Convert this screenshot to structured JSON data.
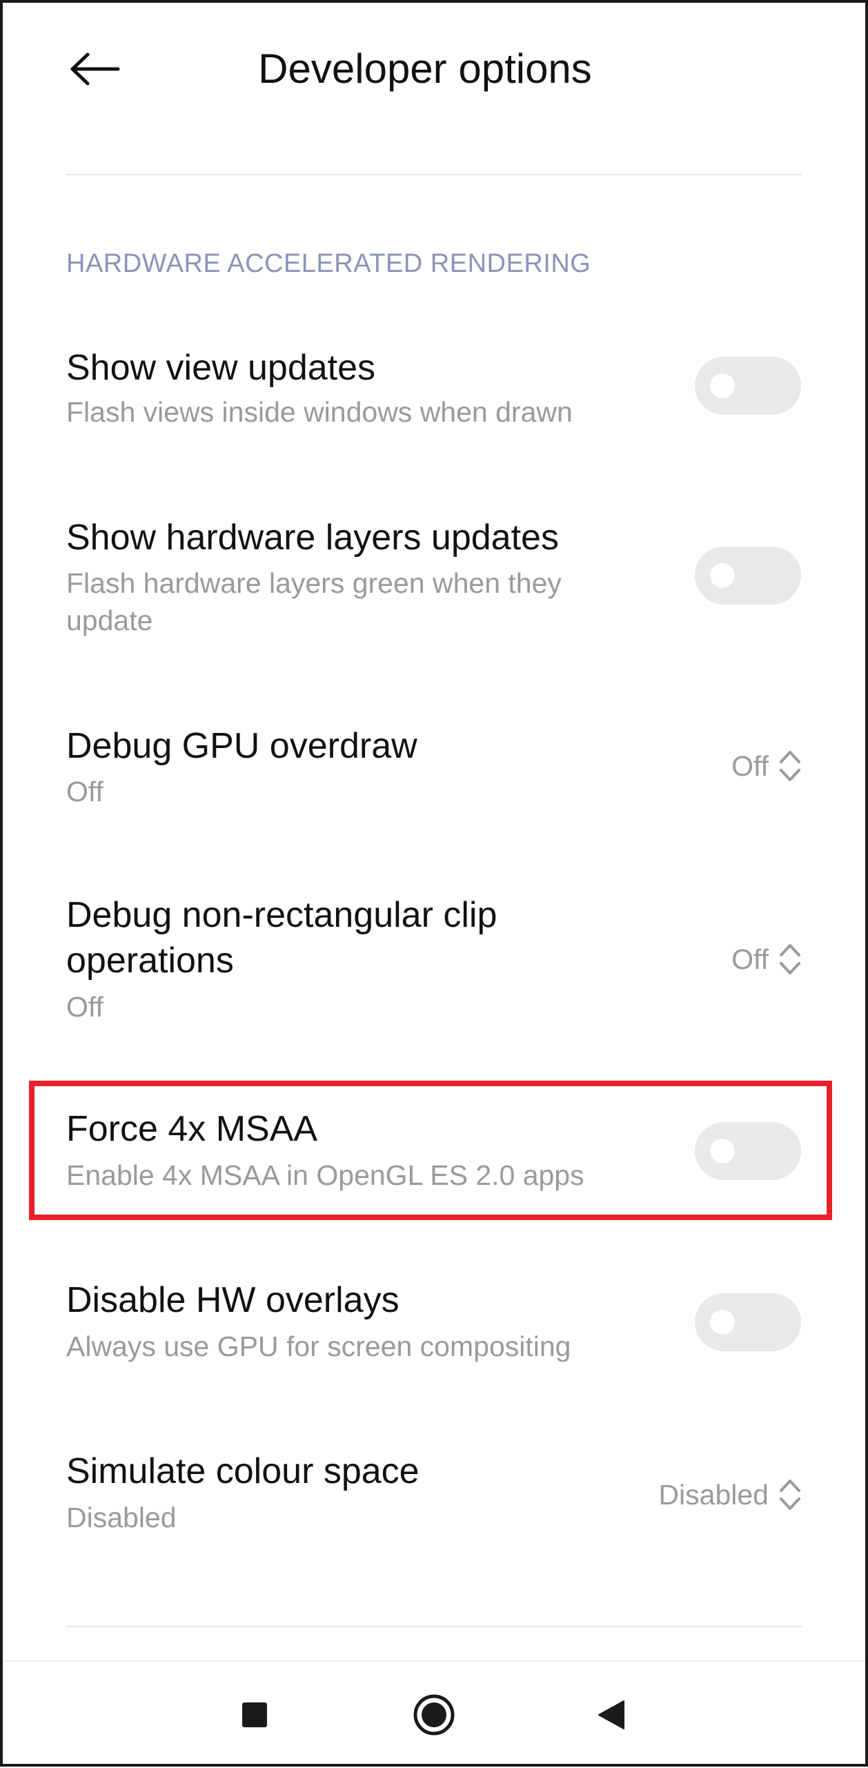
{
  "header": {
    "title": "Developer options",
    "back_icon": "arrow-left-icon"
  },
  "section": {
    "label": "HARDWARE ACCELERATED RENDERING"
  },
  "items": [
    {
      "title": "Show view updates",
      "summary": "Flash views inside windows when drawn",
      "control": "toggle",
      "checked": false
    },
    {
      "title": "Show hardware layers updates",
      "summary": "Flash hardware layers green when they update",
      "control": "toggle",
      "checked": false
    },
    {
      "title": "Debug GPU overdraw",
      "summary": "Off",
      "control": "dropdown",
      "value": "Off"
    },
    {
      "title": "Debug non-rectangular clip operations",
      "summary": "Off",
      "control": "dropdown",
      "value": "Off"
    },
    {
      "title": "Force 4x MSAA",
      "summary": "Enable 4x MSAA in OpenGL ES 2.0 apps",
      "control": "toggle",
      "checked": false,
      "highlighted": true
    },
    {
      "title": "Disable HW overlays",
      "summary": "Always use GPU for screen compositing",
      "control": "toggle",
      "checked": false
    },
    {
      "title": "Simulate colour space",
      "summary": "Disabled",
      "control": "dropdown",
      "value": "Disabled"
    }
  ],
  "navbar": {
    "icons": [
      "recents-square-icon",
      "home-circle-icon",
      "back-triangle-icon"
    ]
  },
  "colors": {
    "section_label": "#8b93b7",
    "highlight": "#e8202a",
    "toggle_off": "#e9e9e9",
    "summary_text": "#9a9a9a"
  }
}
